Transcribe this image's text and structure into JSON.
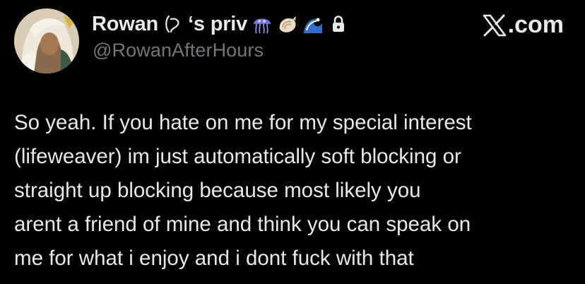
{
  "header": {
    "display_name": "Rowan",
    "display_name_suffix": "‘s priv",
    "handle": "@RowanAfterHours",
    "name_icons": [
      "parenthesis-shape-icon",
      "jellyfish-icon",
      "shell-icon",
      "wave-icon",
      "lock-icon"
    ],
    "brand_label": ".com",
    "brand_icon": "x-logo-icon"
  },
  "tweet": {
    "lines": [
      "So yeah. If you hate on me for my special interest",
      "(lifeweaver) im just automatically soft blocking or",
      "straight up blocking because most likely you",
      "arent a friend of mine and think you can speak on",
      "me for what i enjoy and i dont fuck with that"
    ]
  },
  "colors": {
    "background": "#000000",
    "text_primary": "#e7e9ea",
    "text_secondary": "#71767b"
  }
}
